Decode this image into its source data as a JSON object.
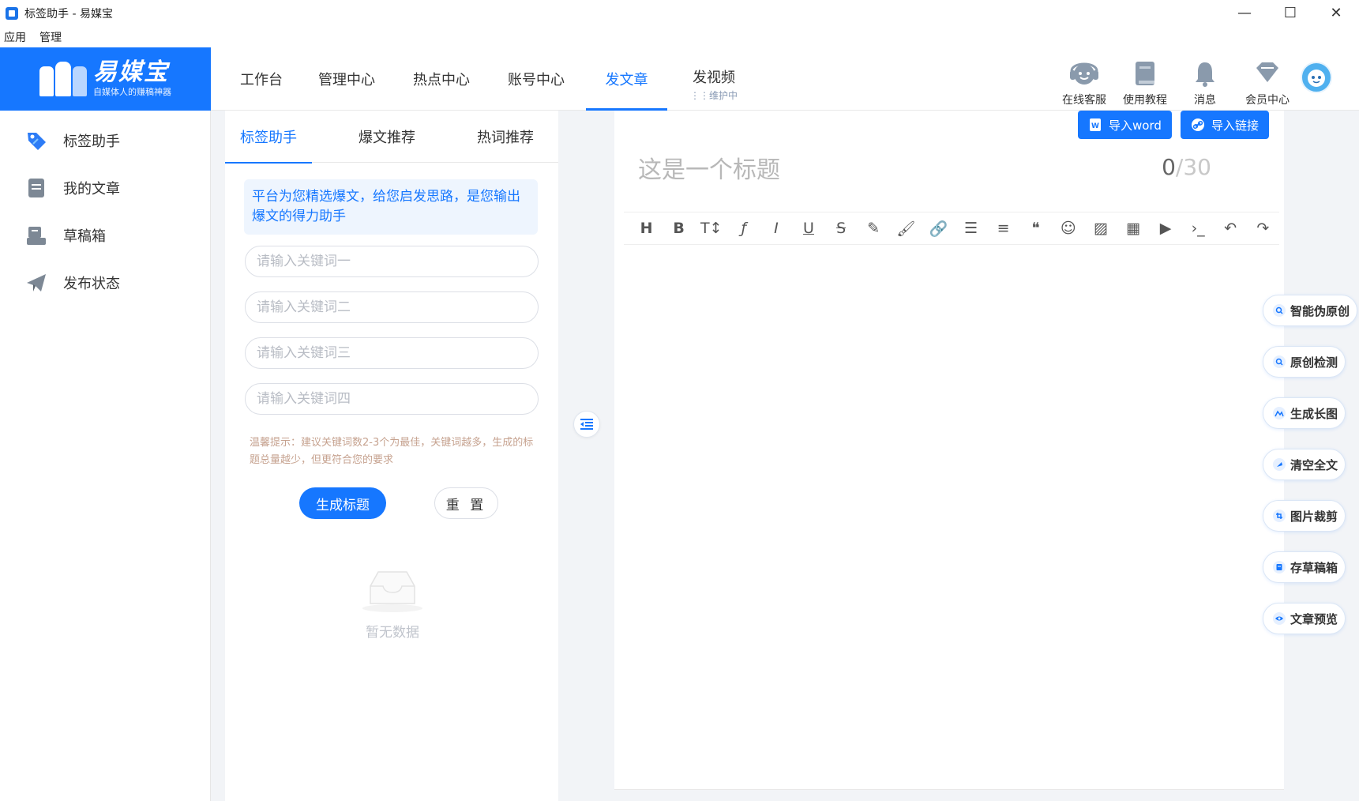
{
  "window": {
    "title": "标签助手 - 易媒宝",
    "controls": {
      "minimize": "—",
      "maximize": "☐",
      "close": "✕"
    }
  },
  "menubar": {
    "items": [
      "应用",
      "管理"
    ]
  },
  "logo": {
    "name": "易媒宝",
    "slogan": "自媒体人的赚稿神器"
  },
  "topnav": {
    "tabs": [
      {
        "label": "工作台"
      },
      {
        "label": "管理中心"
      },
      {
        "label": "热点中心"
      },
      {
        "label": "账号中心"
      },
      {
        "label": "发文章"
      },
      {
        "label": "发视频",
        "sub": "维护中"
      }
    ],
    "active_tab": "发文章",
    "tools": [
      {
        "label": "在线客服",
        "icon": "headset-icon"
      },
      {
        "label": "使用教程",
        "icon": "book-icon"
      },
      {
        "label": "消息",
        "icon": "bell-icon"
      },
      {
        "label": "会员中心",
        "icon": "diamond-icon"
      }
    ]
  },
  "sidebar": {
    "items": [
      {
        "label": "标签助手",
        "icon": "tag-icon"
      },
      {
        "label": "我的文章",
        "icon": "document-icon"
      },
      {
        "label": "草稿箱",
        "icon": "draft-box-icon"
      },
      {
        "label": "发布状态",
        "icon": "paper-plane-icon"
      }
    ]
  },
  "tag_panel": {
    "tabs": [
      "标签助手",
      "爆文推荐",
      "热词推荐"
    ],
    "active_tab": "标签助手",
    "info": "平台为您精选爆文，给您启发思路，是您输出爆文的得力助手",
    "inputs": [
      {
        "placeholder": "请输入关键词一"
      },
      {
        "placeholder": "请输入关键词二"
      },
      {
        "placeholder": "请输入关键词三"
      },
      {
        "placeholder": "请输入关键词四"
      }
    ],
    "tip": "温馨提示：建议关键词数2-3个为最佳，关键词越多，生成的标题总量越少，但更符合您的要求",
    "generate_label": "生成标题",
    "reset_label": "重 置",
    "empty_label": "暂无数据"
  },
  "editor": {
    "import_word": "导入word",
    "import_link": "导入链接",
    "title_placeholder": "这是一个标题",
    "counter_current": "0",
    "counter_sep": "/",
    "counter_max": "30",
    "toolbar": [
      {
        "name": "heading-icon",
        "glyph": "H"
      },
      {
        "name": "bold-icon",
        "glyph": "B"
      },
      {
        "name": "font-size-icon",
        "glyph": "T↕"
      },
      {
        "name": "font-family-icon",
        "glyph": "ƒ"
      },
      {
        "name": "italic-icon",
        "glyph": "I"
      },
      {
        "name": "underline-icon",
        "glyph": "U"
      },
      {
        "name": "strikethrough-icon",
        "glyph": "S"
      },
      {
        "name": "pen-icon",
        "glyph": "✎"
      },
      {
        "name": "brush-icon",
        "glyph": "🖌"
      },
      {
        "name": "link-icon",
        "glyph": "🔗"
      },
      {
        "name": "bullet-list-icon",
        "glyph": "☰"
      },
      {
        "name": "align-icon",
        "glyph": "≡"
      },
      {
        "name": "quote-icon",
        "glyph": "❝"
      },
      {
        "name": "emoji-icon",
        "glyph": "☺"
      },
      {
        "name": "image-icon",
        "glyph": "▨"
      },
      {
        "name": "table-icon",
        "glyph": "▦"
      },
      {
        "name": "video-icon",
        "glyph": "▶"
      },
      {
        "name": "code-icon",
        "glyph": "›_"
      },
      {
        "name": "undo-icon",
        "glyph": "↶"
      },
      {
        "name": "redo-icon",
        "glyph": "↷"
      }
    ]
  },
  "side_actions": [
    {
      "label": "智能伪原创",
      "icon": "ai-rewrite-icon"
    },
    {
      "label": "原创检测",
      "icon": "originality-check-icon"
    },
    {
      "label": "生成长图",
      "icon": "long-image-icon"
    },
    {
      "label": "清空全文",
      "icon": "clear-all-icon"
    },
    {
      "label": "图片裁剪",
      "icon": "crop-icon"
    },
    {
      "label": "存草稿箱",
      "icon": "save-draft-icon"
    },
    {
      "label": "文章预览",
      "icon": "preview-eye-icon"
    }
  ],
  "colors": {
    "accent": "#1677ff",
    "tip": "#c6a28f",
    "info_bg": "#eef5fe"
  }
}
